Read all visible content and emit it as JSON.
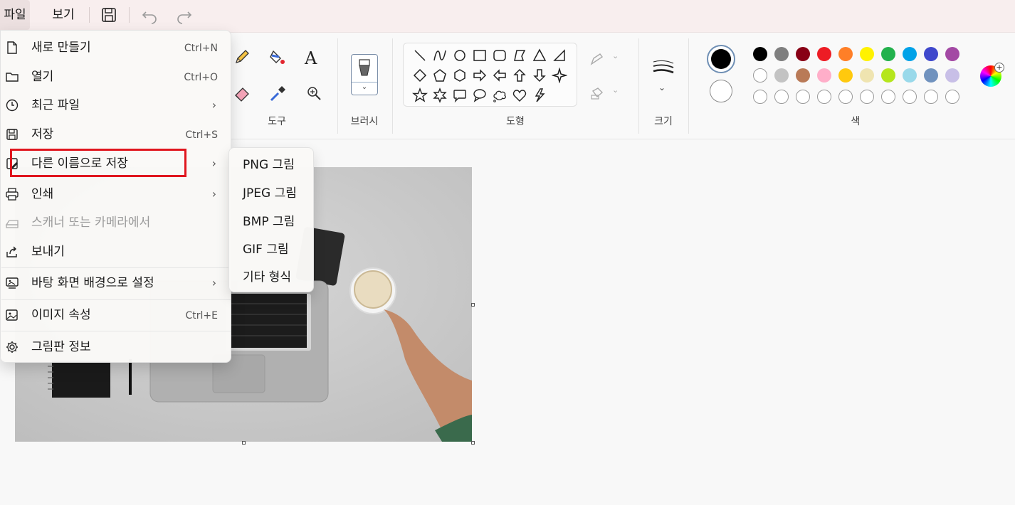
{
  "menubar": {
    "file": "파일",
    "view": "보기",
    "icons": [
      "save-icon",
      "undo-icon",
      "redo-icon"
    ]
  },
  "ribbon": {
    "tools_label": "도구",
    "brushes_label": "브러시",
    "shapes_label": "도형",
    "size_label": "크기",
    "colors_label": "색",
    "tool_icons": [
      "pencil-icon",
      "fill-icon",
      "text-icon",
      "eraser-icon",
      "color-picker-icon",
      "magnifier-icon"
    ],
    "shape_icons": [
      "line",
      "curve",
      "oval",
      "rectangle",
      "rounded-rectangle",
      "polygon",
      "triangle",
      "right-triangle",
      "diamond",
      "pentagon",
      "hexagon",
      "right-arrow",
      "left-arrow",
      "up-arrow",
      "down-arrow",
      "four-point-star",
      "five-point-star",
      "six-point-star",
      "rounded-rect-callout",
      "oval-callout",
      "cloud-callout",
      "heart",
      "lightning"
    ],
    "palette_row1": [
      "#000000",
      "#7f7f7f",
      "#880015",
      "#ed1c24",
      "#ff7f27",
      "#fff200",
      "#22b14c",
      "#00a2e8",
      "#3f48cc",
      "#a349a4"
    ],
    "palette_row2": [
      "#ffffff",
      "#c3c3c3",
      "#b97a57",
      "#ffaec9",
      "#ffc90e",
      "#efe4b0",
      "#b5e61d",
      "#99d9ea",
      "#7092be",
      "#c8bfe7"
    ],
    "color1": "#000000",
    "color2": "#ffffff"
  },
  "file_menu": {
    "items": [
      {
        "label": "새로 만들기",
        "shortcut": "Ctrl+N",
        "icon": "new-file-icon"
      },
      {
        "label": "열기",
        "shortcut": "Ctrl+O",
        "icon": "folder-icon"
      },
      {
        "label": "최근 파일",
        "arrow": "›",
        "icon": "clock-icon"
      },
      {
        "label": "저장",
        "shortcut": "Ctrl+S",
        "icon": "save-icon"
      },
      {
        "label": "다른 이름으로 저장",
        "arrow": "›",
        "icon": "save-as-icon"
      },
      {
        "label": "인쇄",
        "arrow": "›",
        "icon": "printer-icon"
      },
      {
        "label": "스캐너 또는 카메라에서",
        "icon": "scanner-icon",
        "disabled": true
      },
      {
        "label": "보내기",
        "icon": "share-icon"
      },
      {
        "label": "바탕 화면 배경으로 설정",
        "arrow": "›",
        "icon": "desktop-icon"
      },
      {
        "label": "이미지 속성",
        "shortcut": "Ctrl+E",
        "icon": "image-properties-icon"
      },
      {
        "label": "그림판 정보",
        "icon": "gear-icon"
      }
    ]
  },
  "save_as_submenu": {
    "items": [
      "PNG 그림",
      "JPEG 그림",
      "BMP 그림",
      "GIF 그림",
      "기타 형식"
    ]
  }
}
